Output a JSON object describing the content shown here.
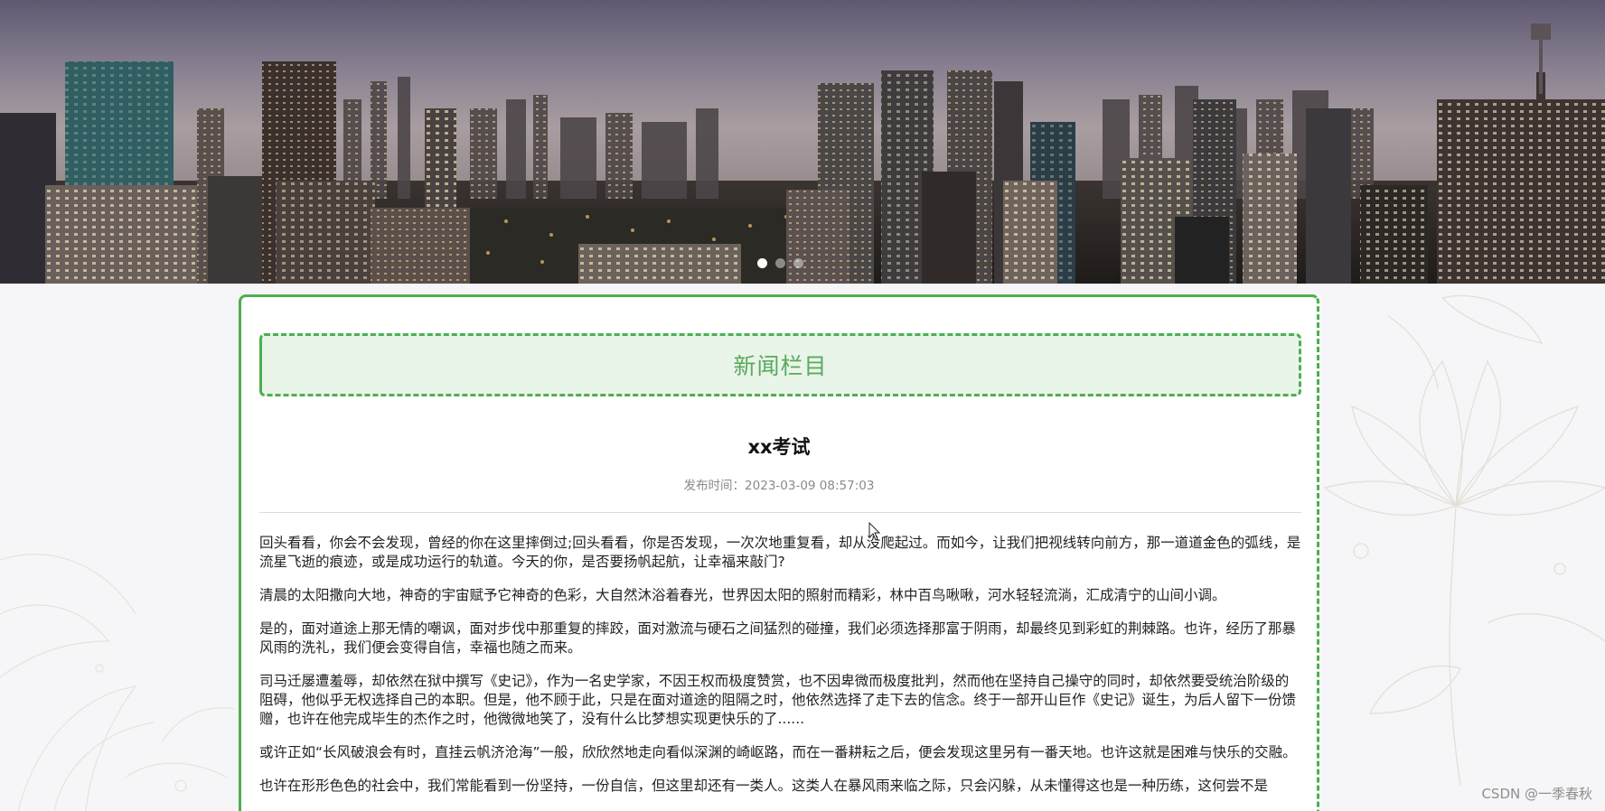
{
  "banner": {
    "carousel": {
      "slide_count": 3,
      "active_index": 0
    }
  },
  "news": {
    "section_title": "新闻栏目",
    "article_title": "xx考试",
    "publish_time": "发布时间：2023-03-09 08:57:03",
    "paragraphs": [
      "回头看看，你会不会发现，曾经的你在这里摔倒过;回头看看，你是否发现，一次次地重复看，却从没爬起过。而如今，让我们把视线转向前方，那一道道金色的弧线，是流星飞逝的痕迹，或是成功运行的轨道。今天的你，是否要扬帆起航，让幸福来敲门?",
      "清晨的太阳撒向大地，神奇的宇宙赋予它神奇的色彩，大自然沐浴着春光，世界因太阳的照射而精彩，林中百鸟啾啾，河水轻轻流淌，汇成清宁的山间小调。",
      "是的，面对道途上那无情的嘲讽，面对步伐中那重复的摔跤，面对激流与硬石之间猛烈的碰撞，我们必须选择那富于阴雨，却最终见到彩虹的荆棘路。也许，经历了那暴风雨的洗礼，我们便会变得自信，幸福也随之而来。",
      "司马迁屡遭羞辱，却依然在狱中撰写《史记》，作为一名史学家，不因王权而极度赞赏，也不因卑微而极度批判，然而他在坚持自己操守的同时，却依然要受统治阶级的阻碍，他似乎无权选择自己的本职。但是，他不顾于此，只是在面对道途的阻隔之时，他依然选择了走下去的信念。终于一部开山巨作《史记》诞生，为后人留下一份馈赠，也许在他完成毕生的杰作之时，他微微地笑了，没有什么比梦想实现更快乐的了......",
      "或许正如“长风破浪会有时，直挂云帆济沧海”一般，欣欣然地走向看似深渊的崎岖路，而在一番耕耘之后，便会发现这里另有一番天地。也许这就是困难与快乐的交融。",
      "也许在形形色色的社会中，我们常能看到一份坚持，一份自信，但这里却还有一类人。这类人在暴风雨来临之际，只会闪躲，从未懂得这也是一种历练，这何尝不是"
    ]
  },
  "watermark": "CSDN @一季春秋"
}
